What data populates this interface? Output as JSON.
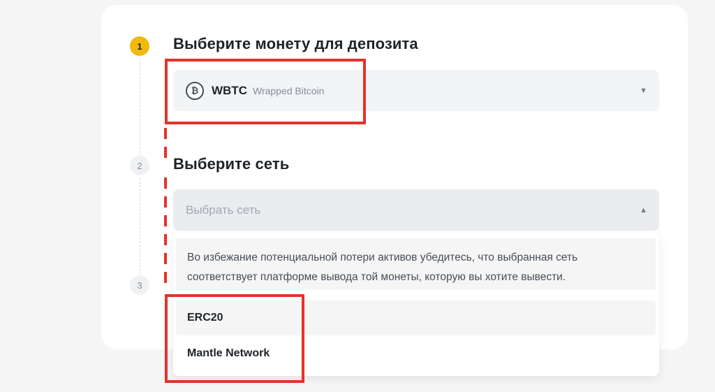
{
  "steps": {
    "one": "1",
    "two": "2",
    "three": "3"
  },
  "coin_section": {
    "title": "Выберите монету для депозита",
    "selected_coin": {
      "ticker": "WBTC",
      "name": "Wrapped Bitcoin",
      "icon": "bitcoin-icon"
    }
  },
  "network_section": {
    "title": "Выберите сеть",
    "placeholder": "Выбрать сеть",
    "notice": "Во избежание потенциальной потери активов убедитесь, что выбранная сеть соответствует платформе вывода той монеты, которую вы хотите вывести.",
    "options": [
      {
        "label": "ERC20"
      },
      {
        "label": "Mantle Network"
      }
    ]
  },
  "colors": {
    "accent": "#f0b90b",
    "annotation": "#e53229"
  }
}
